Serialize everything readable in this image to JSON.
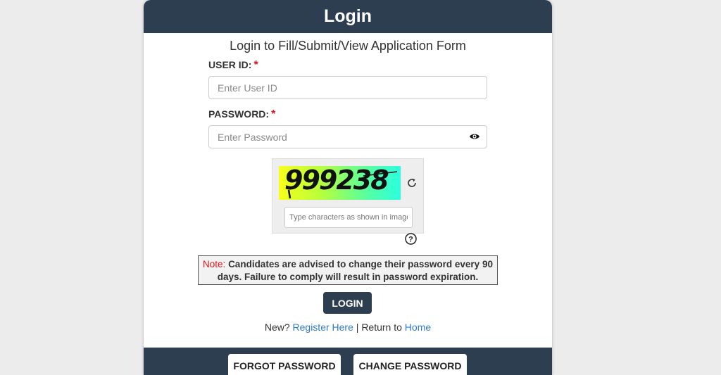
{
  "header": {
    "title": "Login"
  },
  "subtitle": "Login to Fill/Submit/View Application Form",
  "user_id": {
    "label": "USER ID:",
    "required_mark": "*",
    "placeholder": "Enter User ID"
  },
  "password": {
    "label": "PASSWORD:",
    "required_mark": "*",
    "placeholder": "Enter Password"
  },
  "captcha": {
    "code": "999238",
    "placeholder": "Type characters as shown in image"
  },
  "note": {
    "label": "Note:",
    "text": "Candidates are advised to change their password every 90 days. Failure to comply will result in password expiration."
  },
  "login_button": "LOGIN",
  "links": {
    "new_prefix": "New?",
    "register": "Register Here",
    "separator": "|",
    "return_prefix": "Return to",
    "home": "Home"
  },
  "footer": {
    "forgot_password": "FORGOT PASSWORD",
    "change_password": "CHANGE PASSWORD"
  },
  "colors": {
    "header_bg": "#2c3e50",
    "required": "#e0141e",
    "link": "#2e7bc4",
    "page_bg": "#ececec"
  }
}
